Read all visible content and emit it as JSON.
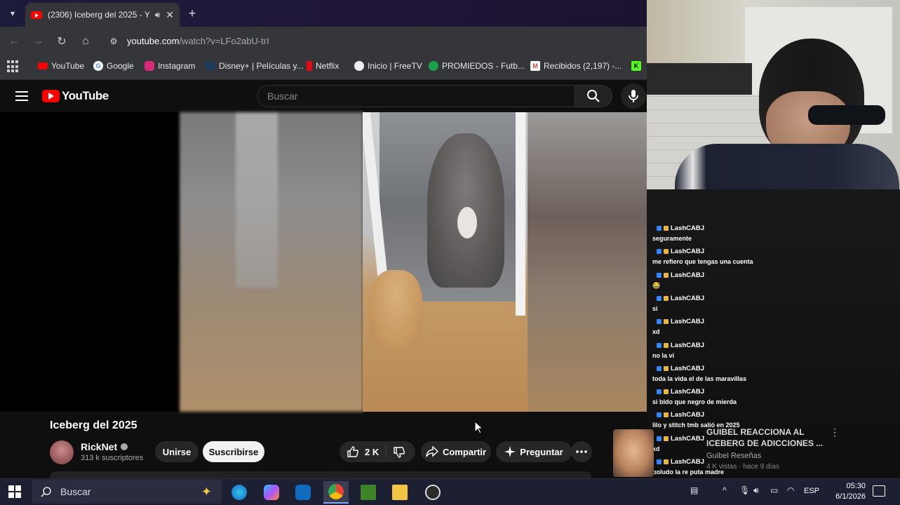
{
  "browser": {
    "tab_title": "(2306) Iceberg del 2025 - Y",
    "url_host": "youtube.com",
    "url_path": "/watch?v=LFo2abU-trI",
    "bookmarks": [
      {
        "label": "YouTube",
        "icon": "youtube-icon",
        "color": "#ff0000"
      },
      {
        "label": "Google",
        "icon": "google-icon",
        "color": "#4285f4"
      },
      {
        "label": "Instagram",
        "icon": "instagram-icon",
        "color": "#d62976"
      },
      {
        "label": "Disney+ | Películas y...",
        "icon": "disney-icon",
        "color": "#113ccf"
      },
      {
        "label": "Netflix",
        "icon": "netflix-icon",
        "color": "#e50914"
      },
      {
        "label": "Inicio | FreeTV",
        "icon": "freetv-icon",
        "color": "#ffffff"
      },
      {
        "label": "PROMIEDOS - Futb...",
        "icon": "promiedos-icon",
        "color": "#1aa34a"
      },
      {
        "label": "Recibidos (2,197) -...",
        "icon": "gmail-icon",
        "color": "#ea4335"
      }
    ]
  },
  "youtube": {
    "logo_text": "YouTube",
    "search_placeholder": "Buscar",
    "video_title": "Iceberg del 2025",
    "channel_name": "RickNet",
    "subscribers": "313 k suscriptores",
    "join_label": "Unirse",
    "subscribe_label": "Suscribirse",
    "likes": "2 K",
    "share_label": "Compartir",
    "ask_label": "Preguntar"
  },
  "chat": {
    "messages": [
      {
        "user": "LashCABJ",
        "text": "seguramente"
      },
      {
        "user": "LashCABJ",
        "text": "me refiero que tengas una cuenta"
      },
      {
        "user": "LashCABJ",
        "text": "😂"
      },
      {
        "user": "LashCABJ",
        "text": "si"
      },
      {
        "user": "LashCABJ",
        "text": "xd"
      },
      {
        "user": "LashCABJ",
        "text": "no la vi"
      },
      {
        "user": "LashCABJ",
        "text": "toda la vida el de las maravillas"
      },
      {
        "user": "LashCABJ",
        "text": "si bldo que negro de mierda"
      },
      {
        "user": "LashCABJ",
        "text": "lilo y stitch tmb salió en 2025"
      },
      {
        "user": "LashCABJ",
        "text": "xd"
      },
      {
        "user": "LashCABJ",
        "text": "boludo la re puta madre"
      }
    ]
  },
  "suggestion": {
    "title": "GUIBEL REACCIONA AL ICEBERG DE ADICCIONES ...",
    "channel": "Guibel Reseñas",
    "meta": "4 K vistas · hace 9 días"
  },
  "taskbar": {
    "search_label": "Buscar",
    "language": "ESP",
    "time": "05:30",
    "date": "6/1/2026"
  }
}
